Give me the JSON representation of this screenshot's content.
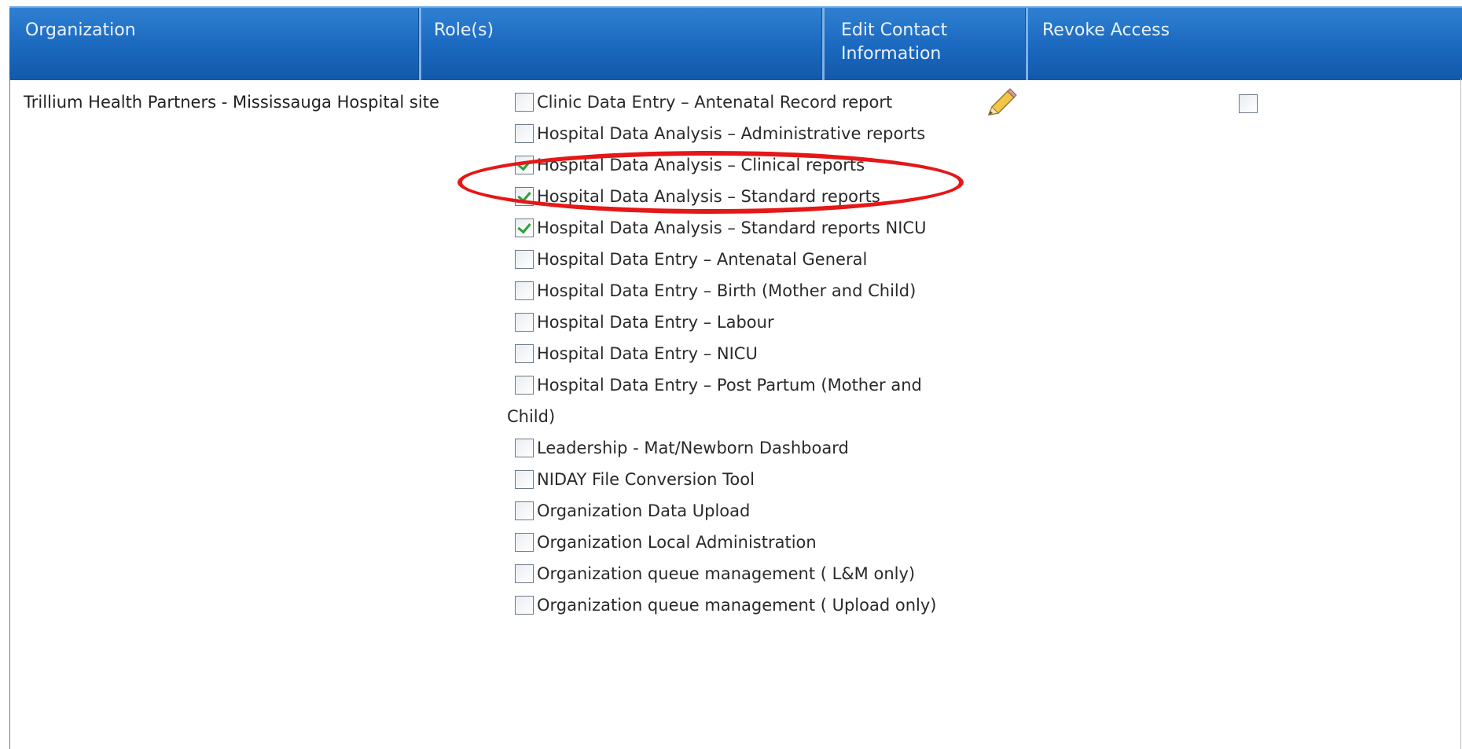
{
  "table": {
    "headers": {
      "organization": "Organization",
      "roles": "Role(s)",
      "edit_contact_line1": "Edit Contact",
      "edit_contact_line2": "Information",
      "revoke": "Revoke Access"
    },
    "row": {
      "organization": "Trillium Health Partners - Mississauga Hospital site",
      "roles": [
        {
          "label": "Clinic Data Entry – Antenatal Record report",
          "checked": false
        },
        {
          "label": "Hospital Data Analysis – Administrative reports",
          "checked": false
        },
        {
          "label": "Hospital Data Analysis – Clinical reports",
          "checked": true
        },
        {
          "label": "Hospital Data Analysis – Standard reports",
          "checked": true
        },
        {
          "label": "Hospital Data Analysis – Standard reports NICU",
          "checked": true
        },
        {
          "label": "Hospital Data Entry – Antenatal General",
          "checked": false
        },
        {
          "label": "Hospital Data Entry – Birth (Mother and Child)",
          "checked": false
        },
        {
          "label": "Hospital Data Entry – Labour",
          "checked": false
        },
        {
          "label": "Hospital Data Entry – NICU",
          "checked": false
        },
        {
          "label": "Hospital Data Entry – Post Partum (Mother and Child)",
          "checked": false
        },
        {
          "label": "Leadership - Mat/Newborn Dashboard",
          "checked": false
        },
        {
          "label": "NIDAY File Conversion Tool",
          "checked": false
        },
        {
          "label": "Organization Data Upload",
          "checked": false
        },
        {
          "label": "Organization Local Administration",
          "checked": false
        },
        {
          "label": "Organization queue management ( L&M only)",
          "checked": false
        },
        {
          "label": "Organization queue management ( Upload only)",
          "checked": false
        }
      ],
      "edit_icon": "pencil-icon",
      "revoke_checked": false
    }
  },
  "colors": {
    "header_bg": "#1a68bf",
    "header_text": "#eaf2fc",
    "check_green": "#2aa335",
    "highlight_red": "#e51717"
  }
}
